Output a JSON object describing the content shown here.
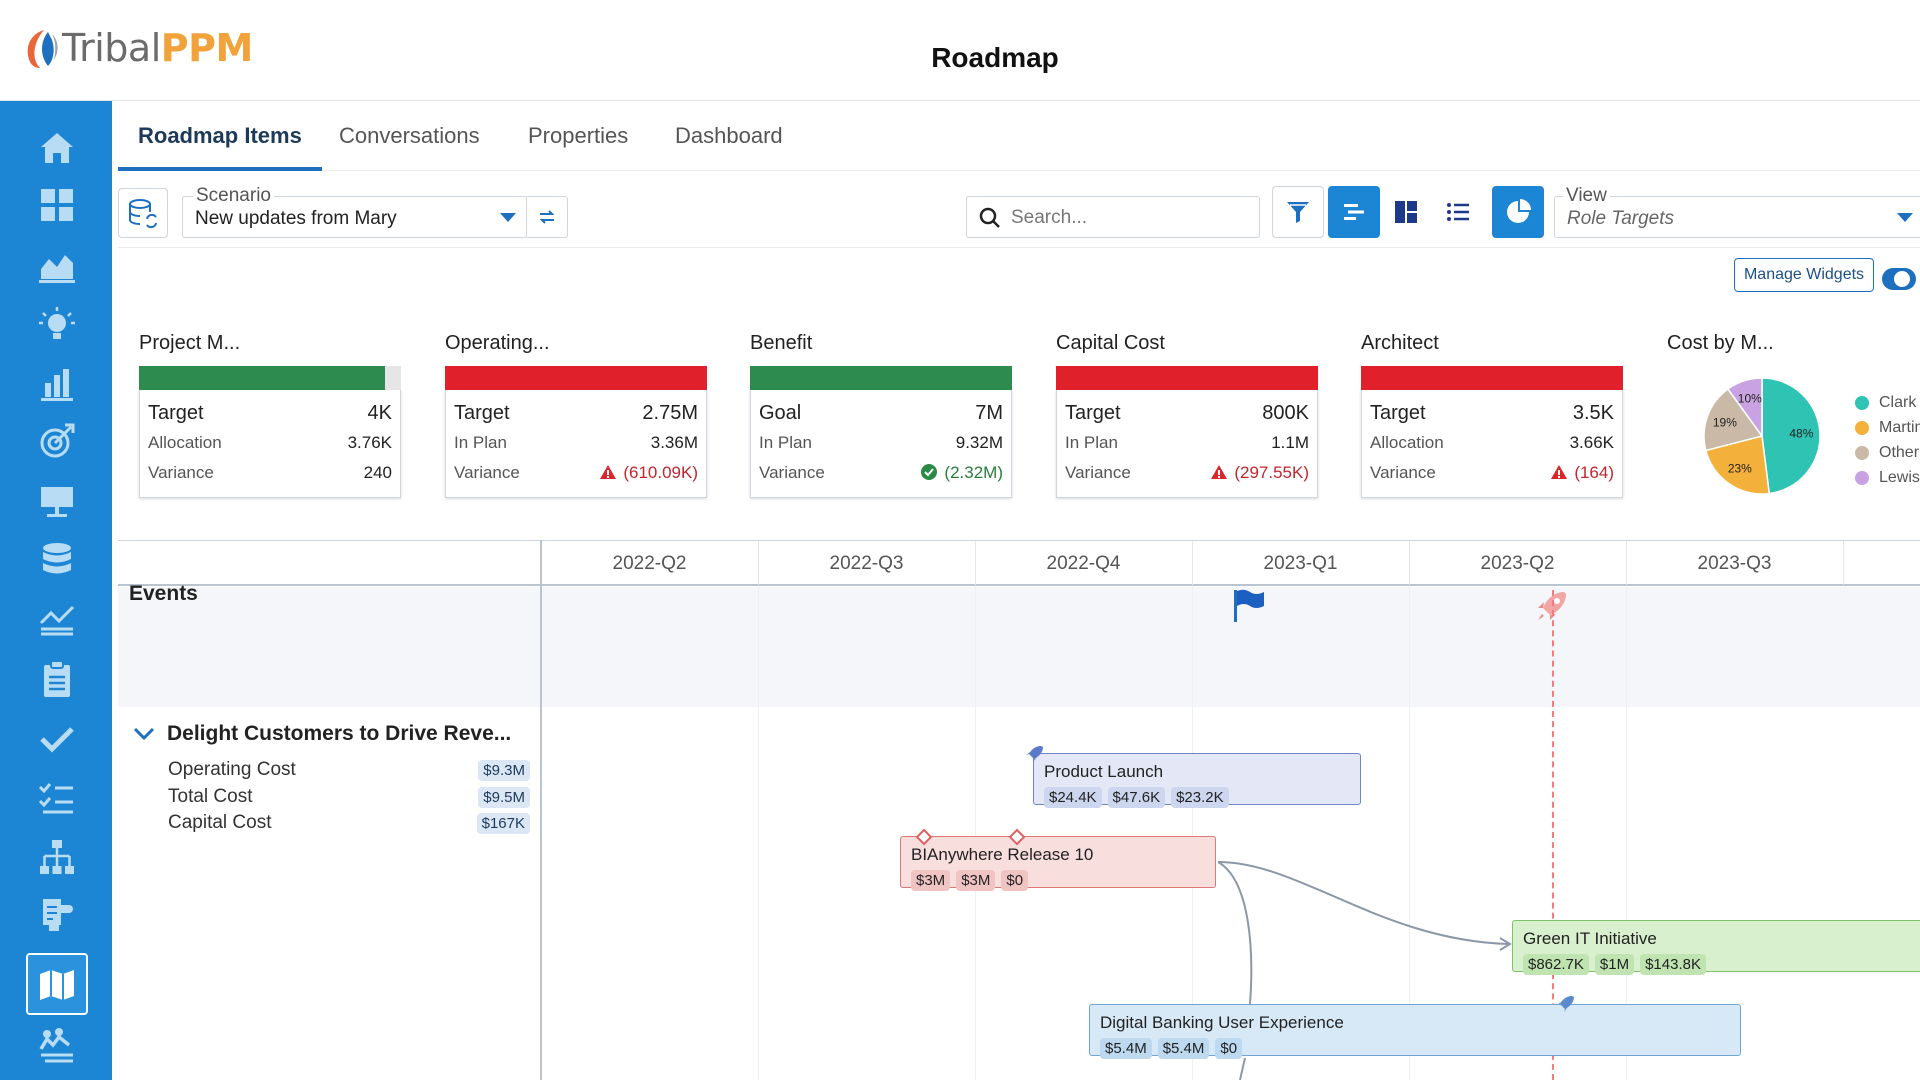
{
  "brand": {
    "name_part1": "Tribal",
    "name_part2": "PPM"
  },
  "header": {
    "title": "Roadmap"
  },
  "sidebar": {
    "items": [
      {
        "icon": "home-icon"
      },
      {
        "icon": "grid-icon"
      },
      {
        "icon": "area-chart-icon"
      },
      {
        "icon": "lightbulb-icon"
      },
      {
        "icon": "bar-chart-icon"
      },
      {
        "icon": "target-icon"
      },
      {
        "icon": "presentation-icon"
      },
      {
        "icon": "database-icon"
      },
      {
        "icon": "line-chart-icon"
      },
      {
        "icon": "clipboard-icon"
      },
      {
        "icon": "checkmark-icon"
      },
      {
        "icon": "checklist-icon"
      },
      {
        "icon": "hierarchy-icon"
      },
      {
        "icon": "puzzle-icon"
      },
      {
        "icon": "map-icon",
        "active": true
      },
      {
        "icon": "team-icon"
      }
    ]
  },
  "tabs": [
    {
      "label": "Roadmap Items",
      "active": true
    },
    {
      "label": "Conversations"
    },
    {
      "label": "Properties"
    },
    {
      "label": "Dashboard"
    }
  ],
  "toolbar": {
    "scenario_label": "Scenario",
    "scenario_value": "New updates from Mary",
    "search_placeholder": "Search...",
    "view_label": "View",
    "view_value": "Role Targets"
  },
  "widgets_bar": {
    "manage_label": "Manage Widgets"
  },
  "widgets": [
    {
      "title": "Project M...",
      "bar_color": "#2e8b4f",
      "bar_fill": 0.94,
      "rows": [
        {
          "k": "Target",
          "v": "4K"
        },
        {
          "k": "Allocation",
          "v": "3.76K"
        },
        {
          "k": "Variance",
          "v": "240",
          "status": "none"
        }
      ]
    },
    {
      "title": "Operating...",
      "bar_color": "#e0202a",
      "bar_fill": 1,
      "rows": [
        {
          "k": "Target",
          "v": "2.75M"
        },
        {
          "k": "In Plan",
          "v": "3.36M"
        },
        {
          "k": "Variance",
          "v": "(610.09K)",
          "status": "bad"
        }
      ]
    },
    {
      "title": "Benefit",
      "bar_color": "#2e8b4f",
      "bar_fill": 1,
      "rows": [
        {
          "k": "Goal",
          "v": "7M"
        },
        {
          "k": "In Plan",
          "v": "9.32M"
        },
        {
          "k": "Variance",
          "v": "(2.32M)",
          "status": "good"
        }
      ]
    },
    {
      "title": "Capital Cost",
      "bar_color": "#e0202a",
      "bar_fill": 1,
      "rows": [
        {
          "k": "Target",
          "v": "800K"
        },
        {
          "k": "In Plan",
          "v": "1.1M"
        },
        {
          "k": "Variance",
          "v": "(297.55K)",
          "status": "bad"
        }
      ]
    },
    {
      "title": "Architect",
      "bar_color": "#e0202a",
      "bar_fill": 1,
      "rows": [
        {
          "k": "Target",
          "v": "3.5K"
        },
        {
          "k": "Allocation",
          "v": "3.66K"
        },
        {
          "k": "Variance",
          "v": "(164)",
          "status": "bad"
        }
      ]
    }
  ],
  "pie_widget": {
    "title": "Cost by M...",
    "slices": [
      {
        "name": "Clark",
        "value": 48,
        "label": "48%",
        "color": "#2fc3b4"
      },
      {
        "name": "Martin",
        "value": 23,
        "label": "23%",
        "color": "#f3b13c"
      },
      {
        "name": "Other",
        "value": 19,
        "label": "19%",
        "color": "#c9b9a6"
      },
      {
        "name": "Lewis",
        "value": 10,
        "label": "10%",
        "color": "#c9a2e3"
      }
    ],
    "legend": [
      "Clark",
      "Martin",
      "Other",
      "Lewis"
    ]
  },
  "timeline": {
    "quarters": [
      "2022-Q2",
      "2022-Q3",
      "2022-Q4",
      "2023-Q1",
      "2023-Q2",
      "2023-Q3"
    ],
    "events_label": "Events",
    "goal": {
      "title": "Delight Customers to Drive Reve...",
      "metrics": [
        {
          "label": "Operating Cost",
          "value": "$9.3M"
        },
        {
          "label": "Total Cost",
          "value": "$9.5M"
        },
        {
          "label": "Capital Cost",
          "value": "$167K"
        }
      ]
    },
    "cards": [
      {
        "title": "Product Launch",
        "tags": [
          "$24.4K",
          "$47.6K",
          "$23.2K"
        ]
      },
      {
        "title": "BIAnywhere Release 10",
        "tags": [
          "$3M",
          "$3M",
          "$0"
        ]
      },
      {
        "title": "Green IT Initiative",
        "tags": [
          "$862.7K",
          "$1M",
          "$143.8K"
        ]
      },
      {
        "title": "Digital Banking User Experience",
        "tags": [
          "$5.4M",
          "$5.4M",
          "$0"
        ]
      }
    ]
  }
}
